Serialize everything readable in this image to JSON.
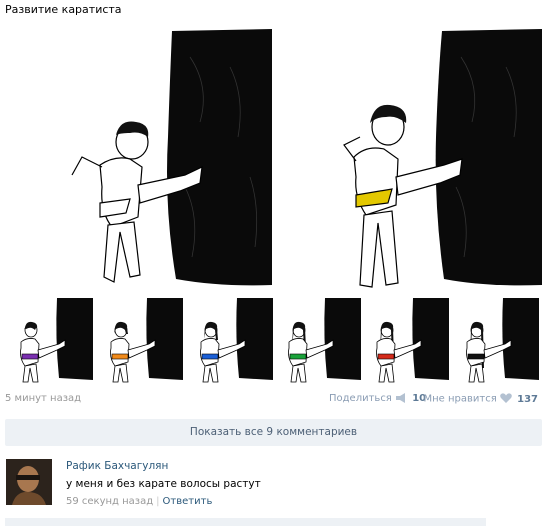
{
  "post": {
    "title": "Развитие каратиста",
    "time": "5 минут назад",
    "share_label": "Поделиться",
    "share_count": "10",
    "like_label": "Мне нравится",
    "like_count": "137"
  },
  "comments_toggle": "Показать все 9 комментариев",
  "comment": {
    "author": "Рафик Бахчагулян",
    "text": "у меня и без карате волосы растут",
    "time": "59 секунд назад",
    "reply_label": "Ответить"
  },
  "belts": [
    "#ffffff",
    "#e3c800",
    "#7a2fb0",
    "#f08a1a",
    "#1a5fd6",
    "#1aa23a",
    "#d42a1a",
    "#111111"
  ],
  "icons": [
    "megaphone-icon",
    "heart-icon"
  ]
}
